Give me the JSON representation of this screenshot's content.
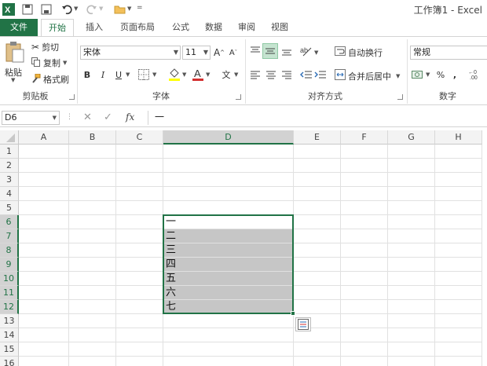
{
  "window": {
    "title": "工作簿1 - Excel"
  },
  "qat": {
    "redo_hint": "",
    "more": "="
  },
  "tabs": [
    {
      "label": "文件"
    },
    {
      "label": "开始"
    },
    {
      "label": "插入"
    },
    {
      "label": "页面布局"
    },
    {
      "label": "公式"
    },
    {
      "label": "数据"
    },
    {
      "label": "审阅"
    },
    {
      "label": "视图"
    }
  ],
  "ribbon": {
    "clipboard": {
      "paste": "粘贴",
      "cut": "剪切",
      "copy": "复制",
      "format_painter": "格式刷",
      "group": "剪贴板"
    },
    "font": {
      "name": "宋体",
      "size": "11",
      "grow": "A",
      "shrink": "A",
      "bold": "B",
      "italic": "I",
      "underline": "U",
      "phonetic": "文",
      "group": "字体",
      "font_color": "#d32f2f",
      "highlight_color": "#ffff00"
    },
    "alignment": {
      "wrap": "自动换行",
      "merge": "合并后居中",
      "group": "对齐方式"
    },
    "number": {
      "format": "常规",
      "percent": "%",
      "comma": ",",
      "group": "数字"
    }
  },
  "formula_bar": {
    "name_box": "D6",
    "cancel": "✕",
    "enter": "✓",
    "fx": "fx",
    "value": "一"
  },
  "sheet": {
    "columns": [
      "A",
      "B",
      "C",
      "D",
      "E",
      "F",
      "G",
      "H"
    ],
    "selected_column": "D",
    "rows": [
      "1",
      "2",
      "3",
      "4",
      "5",
      "6",
      "7",
      "8",
      "9",
      "10",
      "11",
      "12",
      "13",
      "14",
      "15",
      "16"
    ],
    "selected_rows": [
      "6",
      "7",
      "8",
      "9",
      "10",
      "11",
      "12"
    ],
    "d_values": [
      "一",
      "二",
      "三",
      "四",
      "五",
      "六",
      "七"
    ],
    "accent": "#217346"
  }
}
